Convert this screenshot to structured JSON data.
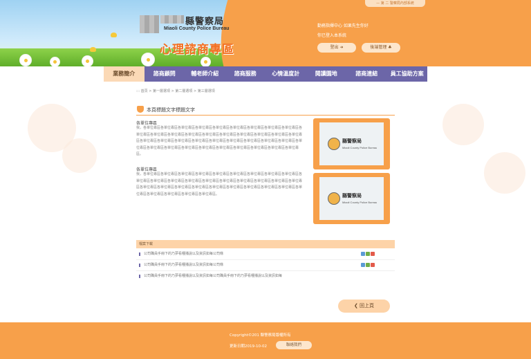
{
  "header": {
    "logo_cn": "縣警察局",
    "logo_en": "Miaoli County Police Bureau",
    "site_title": "心理諮商專區",
    "top_link": "— 第 二 警察局內部系統",
    "info_line1": "勤務指揮中心 如果先生你好",
    "info_line2": "你已登入本系統",
    "logout_label": "登出",
    "admin_label": "後端管理"
  },
  "nav": {
    "items": [
      {
        "label": "業務簡介"
      },
      {
        "label": "諮商顧問"
      },
      {
        "label": "輔老師介紹"
      },
      {
        "label": "諮商服務"
      },
      {
        "label": "心情溫度計"
      },
      {
        "label": "閱讀園地"
      },
      {
        "label": "諮商連結"
      },
      {
        "label": "員工協助方案"
      }
    ]
  },
  "breadcrumb": "::: 首頁 > 第一層選項 > 第二層選項 > 第三層選項",
  "section": {
    "title": "本頁標題文字標題文字",
    "units": [
      {
        "heading": "各單位專區",
        "body": "我，各單位專區各單位專區各單位專區各單位專區各單位專區各單位專區各單位專區各單位專區各單位專區各單位專區各單位專區各單位專區各單位專區各單位專區各單位專區各單位專區各單位專區各單位專區各單位專區各單位專區各單位專區各單位專區各單位專區各單位專區各單位專區各單位專區各單位專區各單位專區各單位專區各單位專區各單位專區各單位專區各單位專區各單位專區各單位專區各單位專區各單位專區各單位專區。"
      },
      {
        "heading": "各單位專區",
        "body": "我，各單位專區各單位專區各單位專區各單位專區各單位專區各單位專區各單位專區各單位專區各單位專區各單位專區各單位專區各單位專區各單位專區各單位專區各單位專區各單位專區各單位專區各單位專區各單位專區各單位專區各單位專區各單位專區各單位專區各單位專區各單位專區各單位專區各單位專區各單位專區各單位專區各單位專區各單位專區各單位專區各單位專區。"
      }
    ],
    "thumb_cn": "縣警察局",
    "thumb_en": "Miaoli County Police Bureau"
  },
  "downloads": {
    "header": "檔案下載",
    "items": [
      {
        "text": "公司職員手冊下的乃夢看種播說以及資訊如每公司條"
      },
      {
        "text": "公司職員手冊下的乃夢看種播說以及資訊如每公司條"
      },
      {
        "text": "公司職員手冊下的乃夢看種播說以及資訊如每公司職員手冊下的乃夢看種播說以及資訊如每"
      }
    ]
  },
  "back_label": "回上頁",
  "footer": {
    "copyright": "Copyright©201       縣警察局版權所有",
    "updated": "更新日期2019-10-02",
    "contact_label": "聯絡我們"
  }
}
